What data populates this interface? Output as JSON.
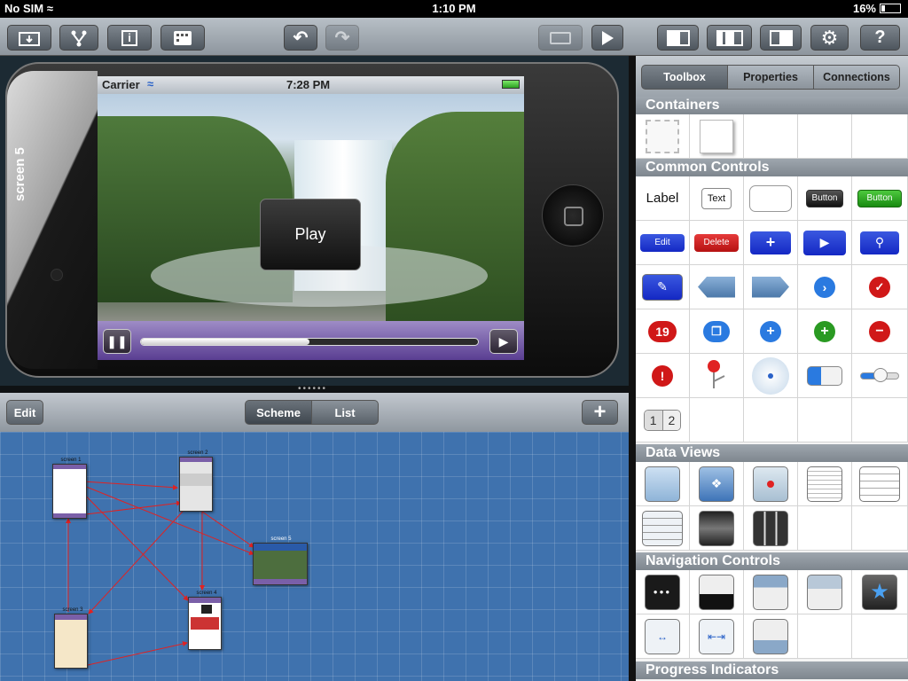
{
  "status_bar": {
    "carrier": "No SIM",
    "time": "1:10 PM",
    "battery": "16%"
  },
  "toolbar": {
    "buttons": [
      "import",
      "share",
      "info",
      "gallery",
      "undo",
      "redo",
      "export",
      "play",
      "layout-left",
      "layout-center",
      "layout-right",
      "settings",
      "help"
    ],
    "help_label": "?"
  },
  "preview": {
    "screen_label": "screen 5",
    "device_status": {
      "carrier": "Carrier",
      "time": "7:28 PM"
    },
    "play_label": "Play",
    "progress": 0.5
  },
  "scheme": {
    "edit_label": "Edit",
    "tabs": [
      "Scheme",
      "List"
    ],
    "selected_tab": "Scheme",
    "screens": [
      "screen 1",
      "screen 2",
      "screen 5",
      "screen 4",
      "screen 3"
    ]
  },
  "toolbox": {
    "tabs": [
      "Toolbox",
      "Properties",
      "Connections"
    ],
    "selected_tab": "Toolbox",
    "sections": {
      "containers": "Containers",
      "common_controls": "Common Controls",
      "data_views": "Data Views",
      "navigation_controls": "Navigation Controls",
      "progress_indicators": "Progress Indicators"
    },
    "controls": {
      "label": "Label",
      "text": "Text",
      "button_dark": "Button",
      "button_green": "Button",
      "edit": "Edit",
      "delete": "Delete",
      "badge": "19",
      "segment_1": "1",
      "segment_2": "2"
    },
    "colors": {
      "accent": "#3f72ae",
      "player": "#5a3e92",
      "green": "#2a9a22",
      "red": "#c01515",
      "blue": "#1428c4"
    }
  }
}
